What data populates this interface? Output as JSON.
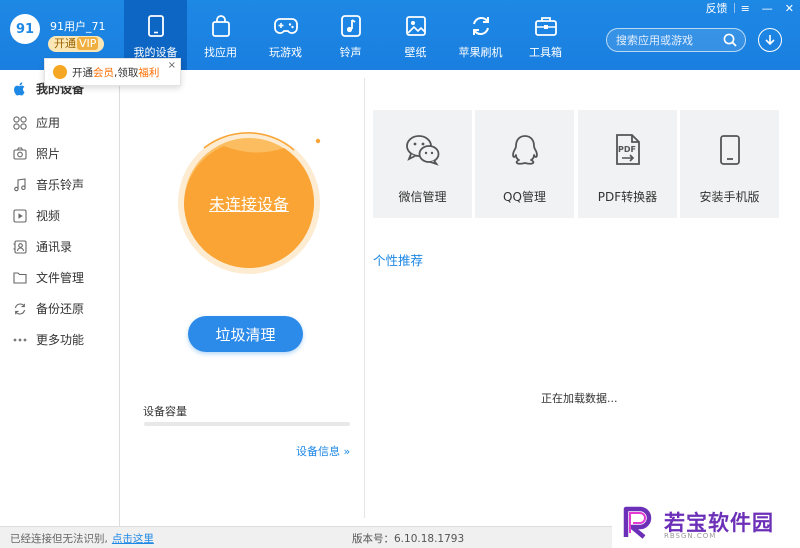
{
  "user": {
    "name": "91用户_71",
    "vip_prefix": "开通",
    "vip_suffix": "VIP"
  },
  "tooltip": {
    "text1": "开通",
    "highlight1": "会员",
    "text2": ",领取",
    "highlight2": "福利",
    "close": "×"
  },
  "nav": {
    "tabs": [
      {
        "label": "我的设备",
        "icon": "phone-icon",
        "active": true
      },
      {
        "label": "找应用",
        "icon": "bag-icon"
      },
      {
        "label": "玩游戏",
        "icon": "gamepad-icon"
      },
      {
        "label": "铃声",
        "icon": "music-note-icon"
      },
      {
        "label": "壁纸",
        "icon": "image-icon"
      },
      {
        "label": "苹果刷机",
        "icon": "refresh-icon"
      },
      {
        "label": "工具箱",
        "icon": "toolbox-icon"
      }
    ]
  },
  "search": {
    "placeholder": "搜索应用或游戏"
  },
  "window": {
    "feedback": "反馈",
    "menu": "≡",
    "minimize": "—",
    "close": "✕"
  },
  "sidebar": {
    "items": [
      {
        "label": "我的设备",
        "icon": "apple-icon"
      },
      {
        "label": "应用",
        "icon": "apps-grid-icon"
      },
      {
        "label": "照片",
        "icon": "camera-icon"
      },
      {
        "label": "音乐铃声",
        "icon": "music-icon"
      },
      {
        "label": "视频",
        "icon": "play-icon"
      },
      {
        "label": "通讯录",
        "icon": "contacts-icon"
      },
      {
        "label": "文件管理",
        "icon": "folder-icon"
      },
      {
        "label": "备份还原",
        "icon": "sync-icon"
      },
      {
        "label": "更多功能",
        "icon": "more-dots-icon"
      }
    ]
  },
  "device": {
    "status": "未连接设备",
    "clean_button": "垃圾清理",
    "capacity_label": "设备容量",
    "info_link": "设备信息 »"
  },
  "tools": {
    "cards": [
      {
        "label": "微信管理",
        "icon": "wechat-icon"
      },
      {
        "label": "QQ管理",
        "icon": "qq-icon"
      },
      {
        "label": "PDF转换器",
        "icon": "pdf-icon"
      },
      {
        "label": "安装手机版",
        "icon": "tablet-icon"
      }
    ]
  },
  "recommend": {
    "title": "个性推荐",
    "loading": "正在加载数据..."
  },
  "statusbar": {
    "status": "已经连接但无法识别,",
    "link": "点击这里",
    "version": "版本号：6.10.18.1793"
  },
  "watermark": {
    "text": "若宝软件园",
    "sub": "RBSGN.COM"
  },
  "colors": {
    "brand": "#1e88e5",
    "orange": "#f9a434",
    "vip": "#fbe7b5",
    "watermark": "#6b2fb8"
  }
}
